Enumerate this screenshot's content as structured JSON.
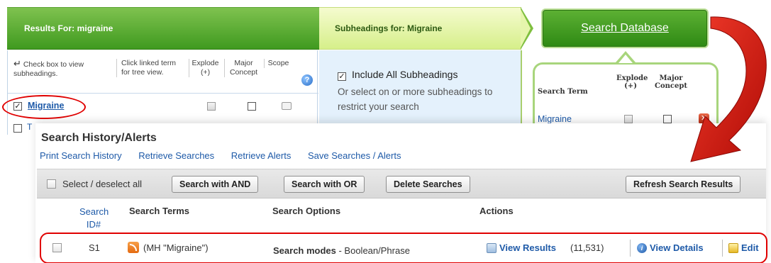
{
  "results_panel": {
    "header": "Results For: migraine",
    "hint_checkbox": "Check box to view subheadings.",
    "hint_linked": "Click linked term for tree view.",
    "col_explode": "Explode (+)",
    "col_major": "Major Concept",
    "col_scope": "Scope",
    "row_term": "Migraine",
    "row2_term": "T"
  },
  "subheadings_panel": {
    "header": "Subheadings for: Migraine",
    "include_all": "Include All Subheadings",
    "instruction": "Or select on or more subheadings to restrict your search"
  },
  "search_database": {
    "button_label": "Search Database",
    "col_term": "Search Term",
    "col_explode": "Explode (+)",
    "col_major": "Major Concept",
    "term": "Migraine"
  },
  "history": {
    "title": "Search History/Alerts",
    "links": [
      "Print Search History",
      "Retrieve Searches",
      "Retrieve Alerts",
      "Save Searches / Alerts"
    ],
    "select_all_label": "Select / deselect all",
    "buttons": {
      "and": "Search with AND",
      "or": "Search with OR",
      "delete": "Delete Searches",
      "refresh": "Refresh Search Results"
    },
    "columns": {
      "search_id": "Search ID#",
      "terms": "Search Terms",
      "options": "Search Options",
      "actions": "Actions"
    },
    "row": {
      "id": "S1",
      "term": "(MH \"Migraine\")",
      "mode_label": "Search modes",
      "mode_value": " - Boolean/Phrase",
      "view_results": "View Results",
      "count": "(11,531)",
      "view_details": "View Details",
      "edit": "Edit"
    }
  },
  "colors": {
    "header_green": "#3f9a1f",
    "link_blue": "#1e5aa8",
    "highlight_red": "#e00000"
  }
}
